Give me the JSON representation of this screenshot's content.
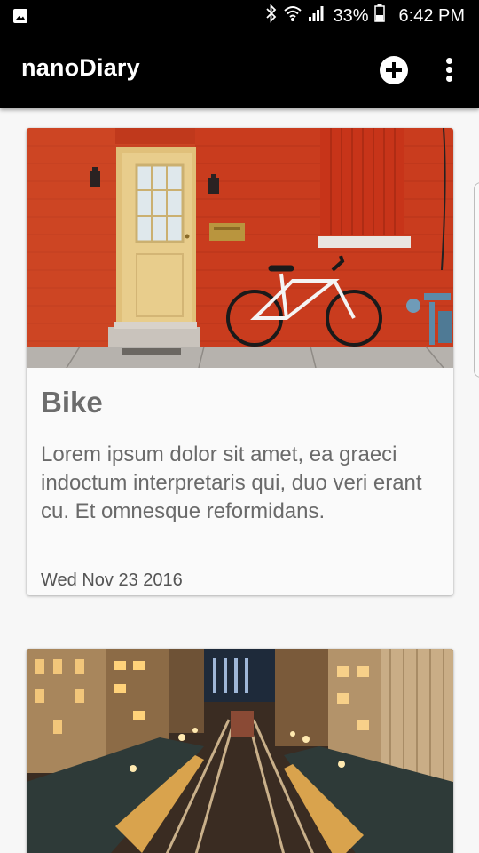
{
  "status_bar": {
    "battery_percent": "33%",
    "time": "6:42 PM",
    "icons": [
      "image-notification-icon",
      "bluetooth-icon",
      "wifi-icon",
      "signal-icon",
      "battery-icon"
    ]
  },
  "app_bar": {
    "title": "nanoDiary",
    "actions": [
      "add-icon",
      "more-vert-icon"
    ]
  },
  "entries": [
    {
      "title": "Bike",
      "body": "Lorem ipsum dolor sit amet, ea graeci indoctum interpretaris qui, duo veri erant cu. Et omnesque reformidans.",
      "date": "Wed Nov 23 2016",
      "image": "red-brick-wall-door-bicycle"
    },
    {
      "title": "",
      "body": "",
      "date": "",
      "image": "city-elevated-train-tracks-night"
    }
  ],
  "colors": {
    "app_bar": "#000000",
    "background": "#f7f7f7",
    "card": "#fafafa",
    "title_text": "#6c6c6c",
    "body_text": "#6a6a6a"
  }
}
